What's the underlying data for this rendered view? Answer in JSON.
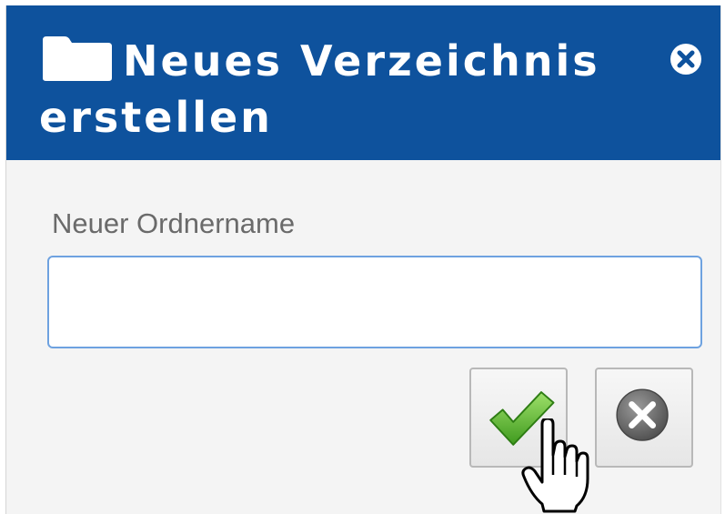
{
  "dialog": {
    "title": "Neues Verzeichnis erstellen",
    "title_icon": "folder-icon",
    "close_icon": "close-icon",
    "colors": {
      "titlebar": "#0e529d",
      "body": "#f4f4f4",
      "input_border": "#6ea2e0"
    }
  },
  "form": {
    "label": "Neuer Ordnername",
    "value": "",
    "placeholder": ""
  },
  "actions": {
    "confirm_icon": "checkmark-icon",
    "cancel_icon": "cancel-icon"
  }
}
